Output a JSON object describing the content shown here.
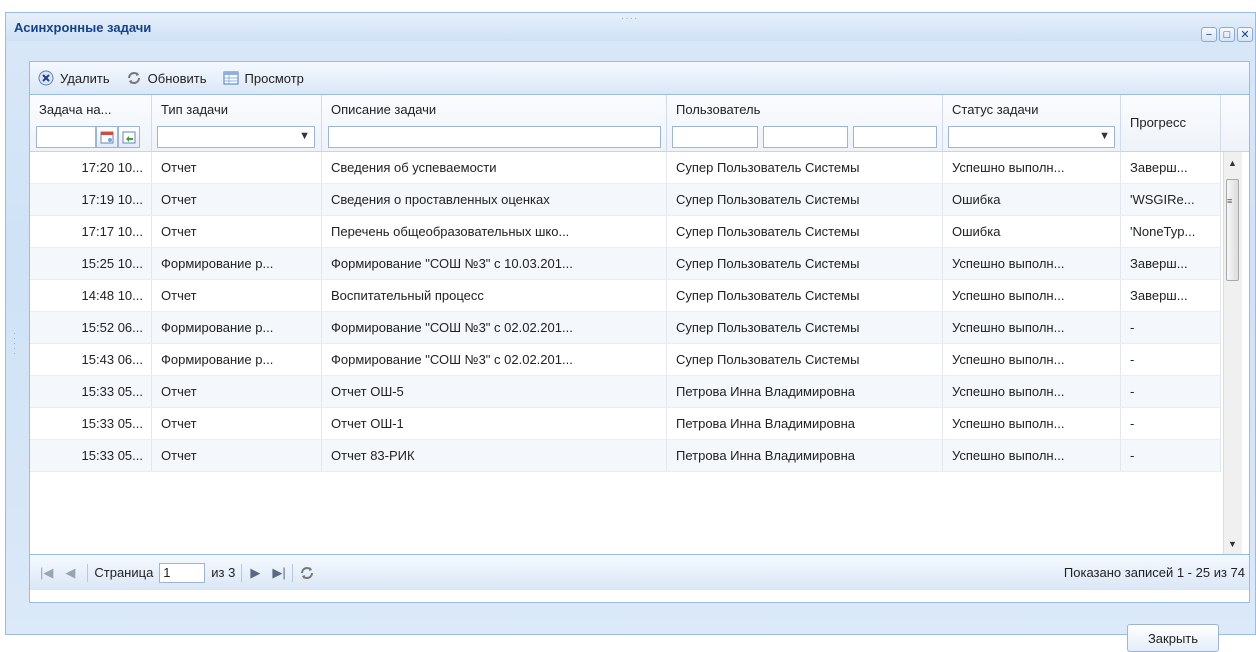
{
  "window": {
    "title": "Асинхронные задачи",
    "controls": [
      "minimize-icon",
      "maximize-icon",
      "close-icon"
    ]
  },
  "toolbar": {
    "delete_label": "Удалить",
    "refresh_label": "Обновить",
    "view_label": "Просмотр"
  },
  "columns": {
    "date": "Задача на...",
    "type": "Тип задачи",
    "desc": "Описание задачи",
    "user": "Пользователь",
    "status": "Статус задачи",
    "progress": "Прогресс"
  },
  "rows": [
    {
      "date": "17:20 10...",
      "type": "Отчет",
      "desc": "Сведения об успеваемости",
      "user": "Супер Пользователь Системы",
      "status": "Успешно выполн...",
      "progress": "Заверш..."
    },
    {
      "date": "17:19 10...",
      "type": "Отчет",
      "desc": "Сведения о проставленных оценках",
      "user": "Супер Пользователь Системы",
      "status": "Ошибка",
      "progress": "'WSGIRe..."
    },
    {
      "date": "17:17 10...",
      "type": "Отчет",
      "desc": "Перечень общеобразовательных шко...",
      "user": "Супер Пользователь Системы",
      "status": "Ошибка",
      "progress": "'NoneTyp..."
    },
    {
      "date": "15:25 10...",
      "type": "Формирование р...",
      "desc": "Формирование \"СОШ №3\" с 10.03.201...",
      "user": "Супер Пользователь Системы",
      "status": "Успешно выполн...",
      "progress": "Заверш..."
    },
    {
      "date": "14:48 10...",
      "type": "Отчет",
      "desc": "Воспитательный процесс",
      "user": "Супер Пользователь Системы",
      "status": "Успешно выполн...",
      "progress": "Заверш..."
    },
    {
      "date": "15:52 06...",
      "type": "Формирование р...",
      "desc": "Формирование \"СОШ №3\" с 02.02.201...",
      "user": "Супер Пользователь Системы",
      "status": "Успешно выполн...",
      "progress": "-"
    },
    {
      "date": "15:43 06...",
      "type": "Формирование р...",
      "desc": "Формирование \"СОШ №3\" с 02.02.201...",
      "user": "Супер Пользователь Системы",
      "status": "Успешно выполн...",
      "progress": "-"
    },
    {
      "date": "15:33 05...",
      "type": "Отчет",
      "desc": "Отчет ОШ-5",
      "user": "Петрова Инна Владимировна",
      "status": "Успешно выполн...",
      "progress": "-"
    },
    {
      "date": "15:33 05...",
      "type": "Отчет",
      "desc": "Отчет ОШ-1",
      "user": "Петрова Инна Владимировна",
      "status": "Успешно выполн...",
      "progress": "-"
    },
    {
      "date": "15:33 05...",
      "type": "Отчет",
      "desc": "Отчет 83-РИК",
      "user": "Петрова Инна Владимировна",
      "status": "Успешно выполн...",
      "progress": "-"
    }
  ],
  "pager": {
    "page_label": "Страница",
    "page_value": "1",
    "of_label": "из 3",
    "info": "Показано записей 1 - 25 из 74"
  },
  "footer": {
    "close_label": "Закрыть"
  },
  "colors": {
    "accent": "#15428b",
    "border": "#99bbe8"
  }
}
